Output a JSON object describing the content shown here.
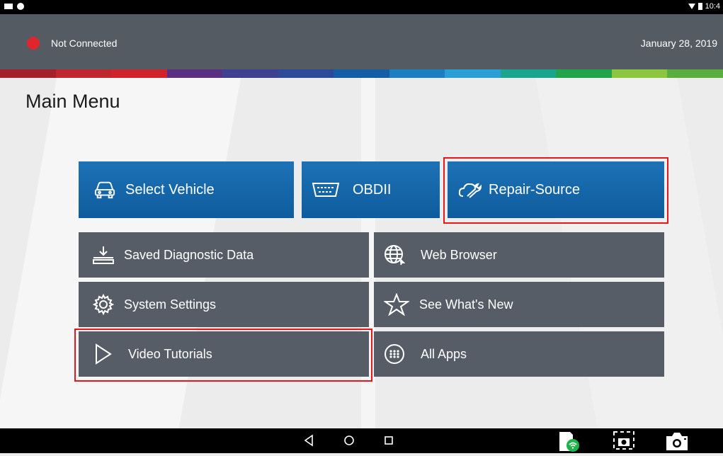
{
  "statusbar": {
    "time": "10:4"
  },
  "header": {
    "connection_status": "Not Connected",
    "date": "January 28, 2019",
    "status_color": "#e0262d"
  },
  "strip_colors": [
    "#a5202b",
    "#c0262d",
    "#d0232b",
    "#5b2e83",
    "#3d3f91",
    "#2c4a98",
    "#145ea6",
    "#1b7ec0",
    "#2a9fd6",
    "#1aa58e",
    "#22a44a",
    "#8cc63f",
    "#5aae3f"
  ],
  "main": {
    "title": "Main Menu",
    "tiles": {
      "select_vehicle": "Select Vehicle",
      "obdii": "OBDII",
      "repair_source": "Repair-Source",
      "saved_data": "Saved Diagnostic Data",
      "web_browser": "Web Browser",
      "system_settings": "System Settings",
      "whats_new": "See What's New",
      "video_tutorials": "Video Tutorials",
      "all_apps": "All Apps"
    }
  },
  "colors": {
    "blue_tile": "#1d72b5",
    "grey_tile": "#565d66",
    "highlight": "#e8161b"
  }
}
